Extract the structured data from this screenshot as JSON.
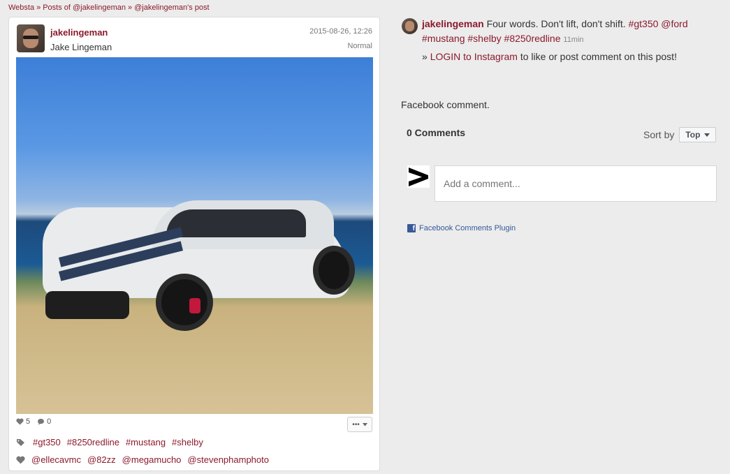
{
  "breadcrumb": {
    "home": "Websta",
    "posts": "Posts of @jakelingeman",
    "current": "@jakelingeman's post",
    "sep": "»"
  },
  "post": {
    "username": "jakelingeman",
    "full_name": "Jake Lingeman",
    "date": "2015-08-26, 12:26",
    "filter": "Normal",
    "likes": "5",
    "comments": "0",
    "more_label": "•••",
    "tags": [
      "#gt350",
      "#8250redline",
      "#mustang",
      "#shelby"
    ],
    "likers": [
      "@ellecavmc",
      "@82zz",
      "@megamucho",
      "@stevenphamphoto"
    ]
  },
  "caption": {
    "username": "jakelingeman",
    "text": "Four words. Don't lift, don't shift.",
    "tag1": "#gt350",
    "mention": "@ford",
    "tag2": "#mustang",
    "tag3": "#shelby",
    "tag4": "#8250redline",
    "ago": "11min",
    "login_prefix": "»",
    "login_link": "LOGIN to Instagram",
    "login_suffix": "to like or post comment on this post!"
  },
  "facebook": {
    "title": "Facebook comment.",
    "count": "0 Comments",
    "sort_label": "Sort by",
    "sort_value": "Top",
    "placeholder": "Add a comment...",
    "plugin_label": "Facebook Comments Plugin",
    "brand_color": "#3b5998"
  },
  "colors": {
    "accent": "#8b1a2b",
    "background": "#ececec"
  }
}
